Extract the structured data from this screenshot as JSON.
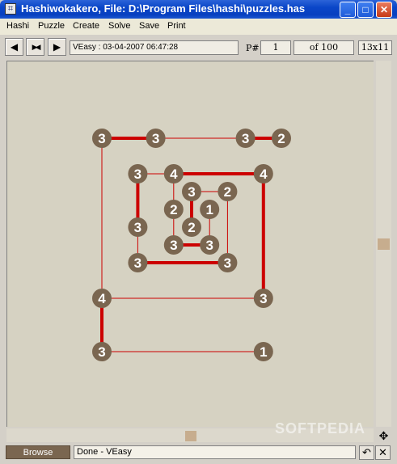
{
  "window": {
    "title": "Hashiwokakero, File: D:\\Program Files\\hashi\\puzzles.has",
    "app_icon": "bridge-grid-icon",
    "minimize": "_",
    "maximize": "□",
    "close": "✕"
  },
  "menu": [
    "Hashi",
    "Puzzle",
    "Create",
    "Solve",
    "Save",
    "Print"
  ],
  "toolbar": {
    "prev_glyph": "◀",
    "first_last_glyph": "▶◀",
    "next_glyph": "▶",
    "status": "VEasy : 03-04-2007 06:47:28",
    "p_label": "P#",
    "p_number": "1",
    "p_total": "of 100",
    "size": "13x11"
  },
  "colors": {
    "island": "#7a6650",
    "bridge": "#cc0000",
    "board": "#d6d2c2"
  },
  "puzzle": {
    "islands": [
      {
        "id": "a",
        "col": 0,
        "row": 0,
        "value": "3"
      },
      {
        "id": "b",
        "col": 3,
        "row": 0,
        "value": "3"
      },
      {
        "id": "c",
        "col": 8,
        "row": 0,
        "value": "3"
      },
      {
        "id": "d",
        "col": 10,
        "row": 0,
        "value": "2"
      },
      {
        "id": "e",
        "col": 2,
        "row": 2,
        "value": "3"
      },
      {
        "id": "f",
        "col": 4,
        "row": 2,
        "value": "4"
      },
      {
        "id": "g",
        "col": 9,
        "row": 2,
        "value": "4"
      },
      {
        "id": "h",
        "col": 5,
        "row": 3,
        "value": "3"
      },
      {
        "id": "i",
        "col": 7,
        "row": 3,
        "value": "2"
      },
      {
        "id": "j",
        "col": 4,
        "row": 4,
        "value": "2"
      },
      {
        "id": "k",
        "col": 6,
        "row": 4,
        "value": "1"
      },
      {
        "id": "l",
        "col": 2,
        "row": 5,
        "value": "3"
      },
      {
        "id": "m",
        "col": 5,
        "row": 5,
        "value": "2"
      },
      {
        "id": "n",
        "col": 4,
        "row": 6,
        "value": "3"
      },
      {
        "id": "o",
        "col": 6,
        "row": 6,
        "value": "3"
      },
      {
        "id": "p",
        "col": 2,
        "row": 7,
        "value": "3"
      },
      {
        "id": "q",
        "col": 7,
        "row": 7,
        "value": "3"
      },
      {
        "id": "r",
        "col": 0,
        "row": 9,
        "value": "4"
      },
      {
        "id": "s",
        "col": 9,
        "row": 9,
        "value": "3"
      },
      {
        "id": "t",
        "col": 0,
        "row": 12,
        "value": "3"
      },
      {
        "id": "u",
        "col": 9,
        "row": 12,
        "value": "1"
      }
    ],
    "bridges": [
      {
        "from": "a",
        "to": "b",
        "count": 2
      },
      {
        "from": "b",
        "to": "c",
        "count": 1
      },
      {
        "from": "c",
        "to": "d",
        "count": 2
      },
      {
        "from": "a",
        "to": "r",
        "count": 1
      },
      {
        "from": "r",
        "to": "s",
        "count": 1
      },
      {
        "from": "r",
        "to": "t",
        "count": 2
      },
      {
        "from": "t",
        "to": "u",
        "count": 1
      },
      {
        "from": "e",
        "to": "f",
        "count": 1
      },
      {
        "from": "f",
        "to": "g",
        "count": 2
      },
      {
        "from": "g",
        "to": "s",
        "count": 2
      },
      {
        "from": "e",
        "to": "l",
        "count": 2
      },
      {
        "from": "l",
        "to": "p",
        "count": 1
      },
      {
        "from": "p",
        "to": "q",
        "count": 2
      },
      {
        "from": "i",
        "to": "q",
        "count": 1
      },
      {
        "from": "f",
        "to": "j",
        "count": 1
      },
      {
        "from": "j",
        "to": "n",
        "count": 1
      },
      {
        "from": "n",
        "to": "o",
        "count": 2
      },
      {
        "from": "h",
        "to": "i",
        "count": 1
      },
      {
        "from": "h",
        "to": "m",
        "count": 2
      },
      {
        "from": "k",
        "to": "o",
        "count": 1
      }
    ]
  },
  "bottom": {
    "browse": "Browse",
    "status": "Done - VEasy",
    "undo_glyph": "↶",
    "cancel_glyph": "✕",
    "corner_glyph": "✥"
  },
  "watermark": "SOFTPEDIA"
}
